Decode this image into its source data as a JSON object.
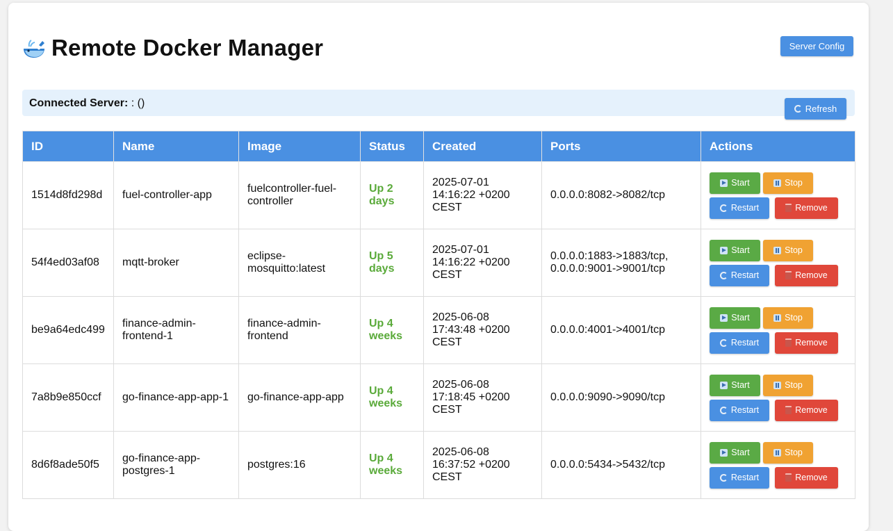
{
  "header": {
    "title": "Remote Docker Manager",
    "server_config_label": "Server Config"
  },
  "server": {
    "label": "Connected Server:",
    "value": ": ()",
    "refresh_label": "Refresh"
  },
  "table": {
    "columns": [
      "ID",
      "Name",
      "Image",
      "Status",
      "Created",
      "Ports",
      "Actions"
    ],
    "rows": [
      {
        "id": "1514d8fd298d",
        "name": "fuel-controller-app",
        "image": "fuelcontroller-fuel-controller",
        "status": "Up 2 days",
        "created": "2025-07-01 14:16:22 +0200 CEST",
        "ports": "0.0.0.0:8082->8082/tcp"
      },
      {
        "id": "54f4ed03af08",
        "name": "mqtt-broker",
        "image": "eclipse-mosquitto:latest",
        "status": "Up 5 days",
        "created": "2025-07-01 14:16:22 +0200 CEST",
        "ports": "0.0.0.0:1883->1883/tcp, 0.0.0.0:9001->9001/tcp"
      },
      {
        "id": "be9a64edc499",
        "name": "finance-admin-frontend-1",
        "image": "finance-admin-frontend",
        "status": "Up 4 weeks",
        "created": "2025-06-08 17:43:48 +0200 CEST",
        "ports": "0.0.0.0:4001->4001/tcp"
      },
      {
        "id": "7a8b9e850ccf",
        "name": "go-finance-app-app-1",
        "image": "go-finance-app-app",
        "status": "Up 4 weeks",
        "created": "2025-06-08 17:18:45 +0200 CEST",
        "ports": "0.0.0.0:9090->9090/tcp"
      },
      {
        "id": "8d6f8ade50f5",
        "name": "go-finance-app-postgres-1",
        "image": "postgres:16",
        "status": "Up 4 weeks",
        "created": "2025-06-08 16:37:52 +0200 CEST",
        "ports": "0.0.0.0:5434->5432/tcp"
      }
    ]
  },
  "actions": {
    "start": "Start",
    "stop": "Stop",
    "restart": "Restart",
    "remove": "Remove"
  },
  "icons": {
    "title": "whale-icon",
    "start": "play-icon",
    "stop": "pause-icon",
    "restart": "refresh-icon",
    "remove": "trash-icon"
  },
  "colors": {
    "primary": "#4a90e2",
    "start": "#5aaa45",
    "stop": "#f0a232",
    "remove": "#e0473a",
    "status": "#5aaa3a",
    "server_bar": "#e5f1fc"
  }
}
